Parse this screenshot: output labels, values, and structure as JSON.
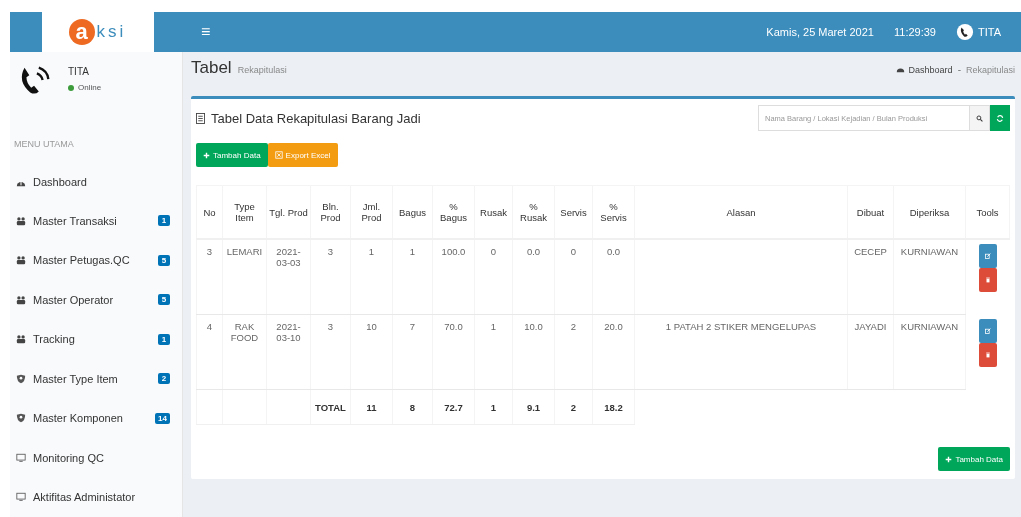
{
  "header": {
    "logo_mark": "a",
    "logo_text": "ksi",
    "menu_toggle": "≡",
    "date": "Kamis, 25 Maret 2021",
    "time": "11:29:39",
    "user": "TITA"
  },
  "sidebar": {
    "user": {
      "name": "TITA",
      "status": "Online"
    },
    "heading": "MENU UTAMA",
    "items": [
      {
        "label": "Dashboard",
        "kind": "dashboard"
      },
      {
        "label": "Master Transaksi",
        "kind": "people",
        "badge": "1"
      },
      {
        "label": "Master Petugas.QC",
        "kind": "people",
        "badge": "5"
      },
      {
        "label": "Master Operator",
        "kind": "people",
        "badge": "5"
      },
      {
        "label": "Tracking",
        "kind": "people",
        "badge": "1"
      },
      {
        "label": "Master Type Item",
        "kind": "master",
        "badge": "2"
      },
      {
        "label": "Master Komponen",
        "kind": "master",
        "badge": "14"
      },
      {
        "label": "Monitoring QC",
        "kind": "screen"
      },
      {
        "label": "Aktifitas Administator",
        "kind": "screen"
      }
    ]
  },
  "page": {
    "title": "Tabel",
    "subtitle": "Rekapitulasi",
    "breadcrumb": [
      "Dashboard",
      "Rekapitulasi"
    ],
    "breadcrumb_separator": "-"
  },
  "box": {
    "title": "Tabel Data Rekapitulasi Barang Jadi",
    "add_button": "Tambah Data",
    "export_button": "Export Excel",
    "search": {
      "placeholder": "Nama Barang / Lokasi Kejadian / Bulan Produksi"
    },
    "bottom_button": "Tambah Data"
  },
  "table": {
    "columns": [
      "No",
      "Type Item",
      "Tgl. Prod",
      "Bln. Prod",
      "Jml. Prod",
      "Bagus",
      "% Bagus",
      "Rusak",
      "% Rusak",
      "Servis",
      "% Servis",
      "Alasan",
      "Dibuat",
      "Diperiksa",
      "Tools"
    ],
    "rows": [
      [
        "3",
        "LEMARI",
        "2021-03-03",
        "3",
        "1",
        "1",
        "100.0",
        "0",
        "0.0",
        "0",
        "0.0",
        "",
        "CECEP",
        "KURNIAWAN"
      ],
      [
        "4",
        "RAK FOOD",
        "2021-03-10",
        "3",
        "10",
        "7",
        "70.0",
        "1",
        "10.0",
        "2",
        "20.0",
        "1 PATAH 2 STIKER MENGELUPAS",
        "JAYADI",
        "KURNIAWAN"
      ]
    ],
    "total": {
      "label": "TOTAL",
      "values": [
        "11",
        "8",
        "72.7",
        "1",
        "9.1",
        "2",
        "18.2"
      ]
    }
  }
}
